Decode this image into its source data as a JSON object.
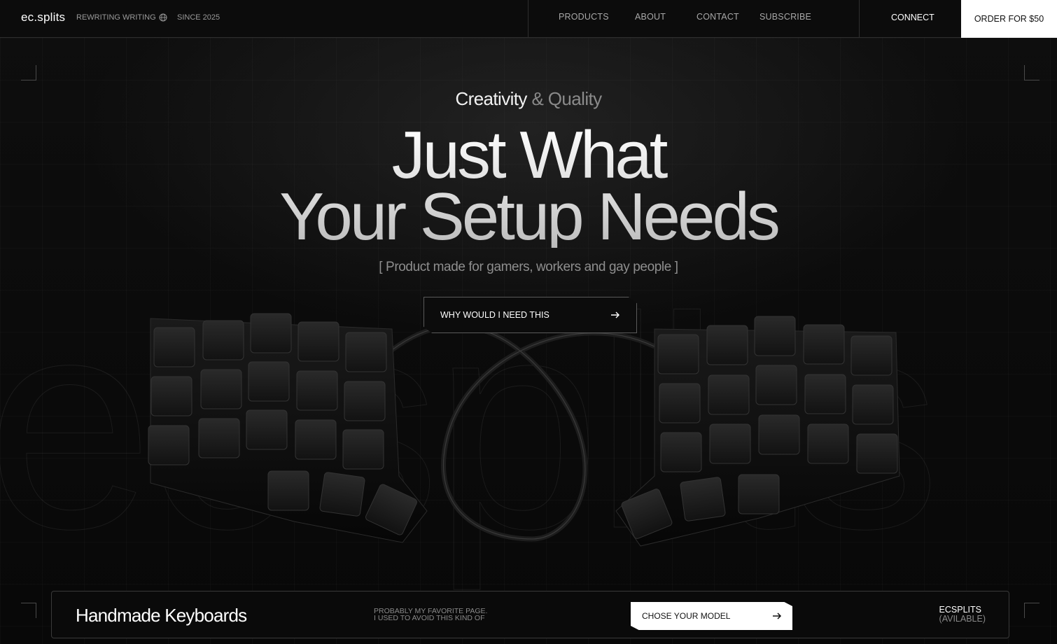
{
  "header": {
    "brand": "ec.splits",
    "tagline": "REWRITING WRITING",
    "since": "SINCE 2025",
    "nav": [
      "PRODUCTS",
      "ABOUT",
      "CONTACT",
      "SUBSCRIBE"
    ],
    "connect": "CONNECT",
    "order": "ORDER FOR $50",
    "globe_icon": "globe-icon"
  },
  "background_wordmark": "ecsplits",
  "hero": {
    "eyebrow_a": "Creativity",
    "eyebrow_b": "& Quality",
    "headline_line1": "Just What",
    "headline_line2": "Your Setup Needs",
    "subline": "[ Product made for gamers, workers and gay people ]",
    "cta": "WHY WOULD I NEED THIS",
    "cta_icon": "arrow-right-icon"
  },
  "bottom_bar": {
    "title": "Handmade Keyboards",
    "note_line1": "PROBABLY MY FAVORITE PAGE.",
    "note_line2": "I USED TO AVOID THIS KIND OF",
    "button": "CHOSE YOUR MODEL",
    "button_icon": "arrow-right-icon",
    "brand": "ECSPLITS",
    "status": "(AVILABLE)"
  },
  "colors": {
    "background": "#0b0b0b",
    "text": "#ffffff",
    "muted": "#8a8a8a",
    "button": "#ffffff"
  }
}
